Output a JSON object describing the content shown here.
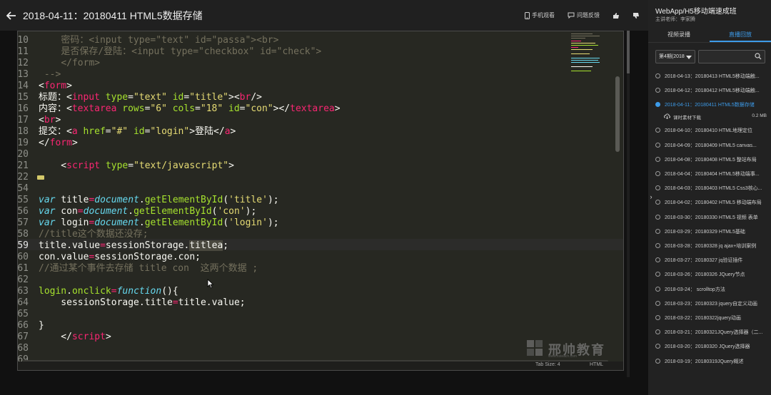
{
  "header": {
    "lesson_title": "2018-04-11：20180411 HTML5数据存储",
    "mobile_watch": "手机观看",
    "feedback": "问题反馈"
  },
  "editor": {
    "lines": [
      {
        "n": "10",
        "html": "    <span class='c-cmt'>密码：&lt;input type=\"text\" id=\"passa\"&gt;&lt;br&gt;</span>"
      },
      {
        "n": "11",
        "html": "    <span class='c-cmt'>是否保存/登陆：&lt;input type=\"checkbox\" id=\"check\"&gt;</span>"
      },
      {
        "n": "12",
        "html": "    <span class='c-cmt'>&lt;/form&gt;</span>"
      },
      {
        "n": "13",
        "html": " <span class='c-cmt'>--&gt;</span>"
      },
      {
        "n": "14",
        "html": "&lt;<span class='c-tag'>form</span>&gt;"
      },
      {
        "n": "15",
        "html": "标题：&lt;<span class='c-tag'>input</span> <span class='c-attr'>type</span>=<span class='c-str'>\"text\"</span> <span class='c-attr'>id</span>=<span class='c-str'>\"title\"</span>&gt;&lt;<span class='c-tag'>br</span>/&gt;"
      },
      {
        "n": "16",
        "html": "内容：&lt;<span class='c-tag'>textarea</span> <span class='c-attr'>rows</span>=<span class='c-str'>\"6\"</span> <span class='c-attr'>cols</span>=<span class='c-str'>\"18\"</span> <span class='c-attr'>id</span>=<span class='c-str'>\"con\"</span>&gt;&lt;/<span class='c-tag'>textarea</span>&gt;"
      },
      {
        "n": "17",
        "html": "&lt;<span class='c-tag'>br</span>&gt;"
      },
      {
        "n": "18",
        "html": "提交：&lt;<span class='c-tag'>a</span> <span class='c-attr'>href</span>=<span class='c-str'>\"#\"</span> <span class='c-attr'>id</span>=<span class='c-str'>\"login\"</span>&gt;登陆&lt;/<span class='c-tag'>a</span>&gt;"
      },
      {
        "n": "19",
        "html": "&lt;/<span class='c-tag'>form</span>&gt;"
      },
      {
        "n": "20",
        "html": ""
      },
      {
        "n": "21",
        "html": "    &lt;<span class='c-tag'>script</span> <span class='c-attr'>type</span>=<span class='c-str'>\"text/javascript\"</span>&gt;"
      },
      {
        "n": "22",
        "html": "",
        "fold": true
      },
      {
        "n": "54",
        "html": ""
      },
      {
        "n": "55",
        "html": "<span class='c-kw'>var</span> title<span class='c-op'>=</span><span class='c-obj'>document</span>.<span class='c-fn'>getElementById</span>(<span class='c-str'>'title'</span>);"
      },
      {
        "n": "56",
        "html": "<span class='c-kw'>var</span> con<span class='c-op'>=</span><span class='c-obj'>document</span>.<span class='c-fn'>getElementById</span>(<span class='c-str'>'con'</span>);"
      },
      {
        "n": "57",
        "html": "<span class='c-kw'>var</span> login<span class='c-op'>=</span><span class='c-obj'>document</span>.<span class='c-fn'>getElementById</span>(<span class='c-str'>'login'</span>);"
      },
      {
        "n": "58",
        "html": "<span class='c-cmt'>//title这个数据还没存;</span>"
      },
      {
        "n": "59",
        "html": "title.value<span class='c-op'>=</span>sessionStorage.<span class='sel'>titlea</span>;",
        "current": true
      },
      {
        "n": "60",
        "html": "con.value<span class='c-op'>=</span>sessionStorage.con;"
      },
      {
        "n": "61",
        "html": "<span class='c-cmt'>//通过某个事件去存储 title con  这两个数据 ;</span>"
      },
      {
        "n": "62",
        "html": ""
      },
      {
        "n": "63",
        "html": "<span class='c-fn'>login</span>.<span class='c-fn'>onclick</span><span class='c-op'>=</span><span class='c-kw'>function</span>(){"
      },
      {
        "n": "64",
        "html": "    sessionStorage.title<span class='c-op'>=</span>title.value;"
      },
      {
        "n": "65",
        "html": ""
      },
      {
        "n": "66",
        "html": "}"
      },
      {
        "n": "67",
        "html": "    &lt;/<span class='c-tag'>script</span>&gt;"
      },
      {
        "n": "68",
        "html": ""
      },
      {
        "n": "69",
        "html": ""
      }
    ],
    "status_tab_size": "Tab Size: 4",
    "status_syntax": "HTML",
    "watermark_text": "邢帅教育",
    "watermark_url": "www.xsteach.com"
  },
  "side": {
    "course_title": "WebApp/H5移动端速成班",
    "teacher": "主讲老师：李家腾",
    "tabs": [
      {
        "label": "视频录播",
        "active": false
      },
      {
        "label": "直播回放",
        "active": true
      }
    ],
    "period_select": "第4期(2018",
    "material_label": "课时素材下载",
    "material_size": "0.2 MB",
    "lessons": [
      {
        "label": "2018-04-13：20180413 HTML5移动端触..."
      },
      {
        "label": "2018-04-12：20180412 HTML5移动端触..."
      },
      {
        "label": "2018-04-11：20180411 HTML5数据存储",
        "active": true
      },
      {
        "label": "2018-04-10：20180410 HTML地理定位"
      },
      {
        "label": "2018-04-09：20180409 HTML5 canvas..."
      },
      {
        "label": "2018-04-08：20180408 HTML5 整站布局"
      },
      {
        "label": "2018-04-04：20180404 HTML5移动端事..."
      },
      {
        "label": "2018-04-03：20180403 HTML5 Css3核心..."
      },
      {
        "label": "2018-04-02：20180402 HTML5 移动端布局"
      },
      {
        "label": "2018-03-30：20180330 HTML5 视频 表单"
      },
      {
        "label": "2018-03-29：20180329 HTML5基础"
      },
      {
        "label": "2018-03-28：20180328 jq ajax+培训案例"
      },
      {
        "label": "2018-03-27：20180327 jq验证插件"
      },
      {
        "label": "2018-03-26：20180326 JQuery节点"
      },
      {
        "label": "2018-03-24： scrolltop方法"
      },
      {
        "label": "2018-03-23：20180323 jquery自定义动画"
      },
      {
        "label": "2018-03-22：20180322jquery动画"
      },
      {
        "label": "2018-03-21：20180321JQuery选择器（二..."
      },
      {
        "label": "2018-03-20：20180320 JQuery选择器"
      },
      {
        "label": "2018-03-19：20180319JQuery概述"
      }
    ]
  }
}
